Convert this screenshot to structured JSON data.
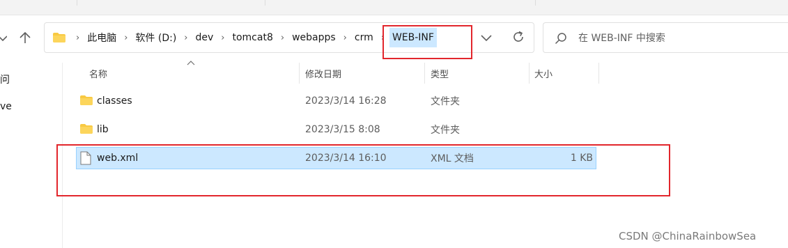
{
  "address_bar": {
    "breadcrumbs": [
      "此电脑",
      "软件 (D:)",
      "dev",
      "tomcat8",
      "webapps",
      "crm",
      "WEB-INF"
    ],
    "separator": "›"
  },
  "search": {
    "placeholder": "在 WEB-INF 中搜索"
  },
  "sidebar": {
    "partial_items": [
      "问",
      "ve"
    ]
  },
  "columns": {
    "name": "名称",
    "date": "修改日期",
    "type": "类型",
    "size": "大小"
  },
  "files": [
    {
      "name": "classes",
      "date": "2023/3/14 16:28",
      "type": "文件夹",
      "size": "",
      "icon": "folder-icon"
    },
    {
      "name": "lib",
      "date": "2023/3/15 8:08",
      "type": "文件夹",
      "size": "",
      "icon": "folder-icon"
    },
    {
      "name": "web.xml",
      "date": "2023/3/14 16:10",
      "type": "XML 文档",
      "size": "1 KB",
      "icon": "file-icon"
    }
  ],
  "selected_file": "web.xml",
  "annotation_color": "#e2262c",
  "selection_color": "#cce8ff",
  "folder_color": "#f8c942",
  "watermark": "CSDN @ChinaRainbowSea"
}
